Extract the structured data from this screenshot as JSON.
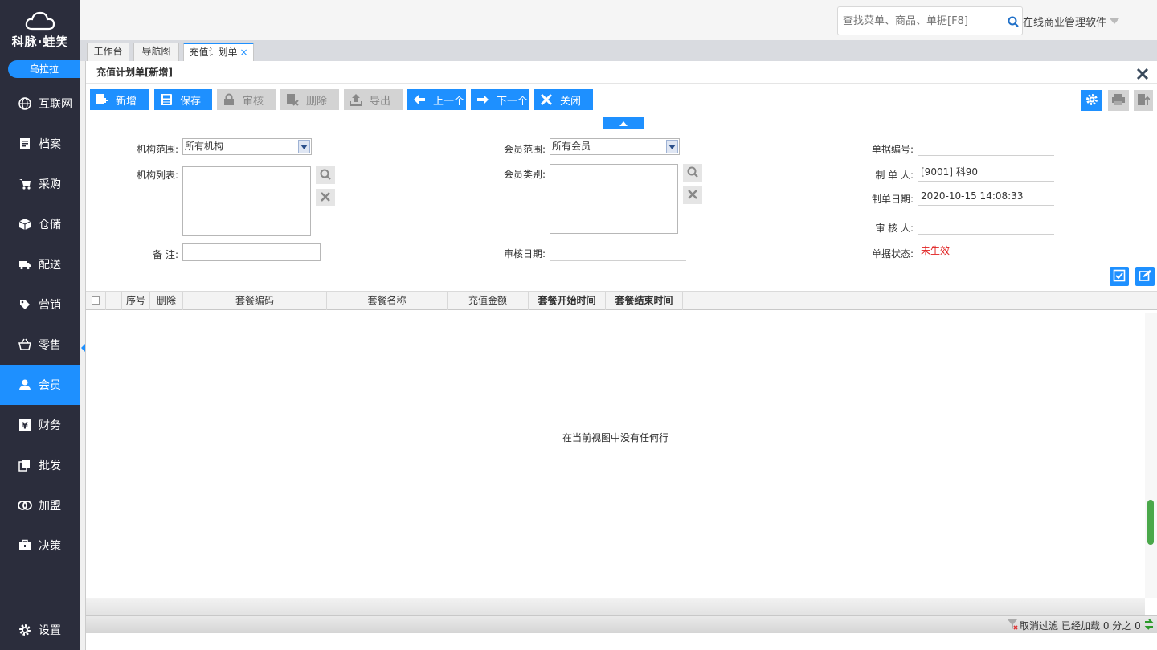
{
  "brand": {
    "logo_text": "科脉·蛙笑",
    "user": "乌拉拉"
  },
  "nav": {
    "items": [
      {
        "label": "互联网",
        "icon": "globe-icon"
      },
      {
        "label": "档案",
        "icon": "file-icon"
      },
      {
        "label": "采购",
        "icon": "cart-icon"
      },
      {
        "label": "仓储",
        "icon": "box-icon"
      },
      {
        "label": "配送",
        "icon": "truck-icon"
      },
      {
        "label": "营销",
        "icon": "tag-icon"
      },
      {
        "label": "零售",
        "icon": "basket-icon"
      },
      {
        "label": "会员",
        "icon": "user-icon",
        "active": true
      },
      {
        "label": "财务",
        "icon": "yen-icon"
      },
      {
        "label": "批发",
        "icon": "copy-icon"
      },
      {
        "label": "加盟",
        "icon": "rings-icon"
      },
      {
        "label": "决策",
        "icon": "briefcase-icon"
      }
    ],
    "settings_label": "设置"
  },
  "header": {
    "search_placeholder": "查找菜单、商品、单据[F8]",
    "app_name": "在线商业管理软件"
  },
  "tabs": [
    {
      "label": "工作台"
    },
    {
      "label": "导航图"
    },
    {
      "label": "充值计划单",
      "active": true,
      "closable": "×"
    }
  ],
  "panel": {
    "title": "充值计划单[新增]",
    "toolbar": {
      "new": "新增",
      "save": "保存",
      "audit": "审核",
      "delete": "删除",
      "export": "导出",
      "prev": "上一个",
      "next": "下一个",
      "close": "关闭"
    }
  },
  "form": {
    "org_scope_label": "机构范围:",
    "org_scope_value": "所有机构",
    "org_list_label": "机构列表:",
    "remark_label": "备 注:",
    "member_scope_label": "会员范围:",
    "member_scope_value": "所有会员",
    "member_type_label": "会员类别:",
    "audit_date_label": "审核日期:",
    "doc_no_label": "单据编号:",
    "doc_no_value": "",
    "maker_label": "制 单 人:",
    "maker_value": "[9001] 科90",
    "make_date_label": "制单日期:",
    "make_date_value": "2020-10-15 14:08:33",
    "auditor_label": "审 核 人:",
    "auditor_value": "",
    "status_label": "单据状态:",
    "status_value": "未生效",
    "status_color": "#e02020"
  },
  "grid": {
    "columns": [
      "序号",
      "删除",
      "套餐编码",
      "套餐名称",
      "充值金额",
      "套餐开始时间",
      "套餐结束时间"
    ],
    "empty_message": "在当前视图中没有任何行"
  },
  "statusbar": {
    "cancel_filter": "取消过滤",
    "loaded": "已经加载 0 分之 0"
  },
  "colors": {
    "accent": "#1e90ff",
    "sidebar": "#2b2d3c"
  }
}
